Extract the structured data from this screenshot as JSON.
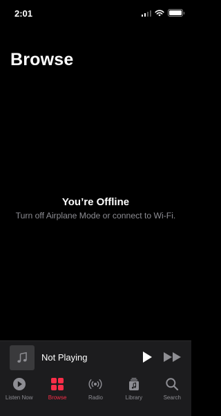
{
  "status_bar": {
    "time": "2:01"
  },
  "page": {
    "title": "Browse"
  },
  "offline": {
    "title": "You’re Offline",
    "subtitle": "Turn off Airplane Mode or connect to Wi-Fi."
  },
  "mini_player": {
    "label": "Not Playing",
    "artwork_icon": "music-note-icon",
    "play_icon": "play-icon",
    "forward_icon": "fast-forward-icon"
  },
  "tab_bar": {
    "tabs": [
      {
        "label": "Listen Now",
        "icon": "play-circle-icon",
        "active": false
      },
      {
        "label": "Browse",
        "icon": "grid-icon",
        "active": true
      },
      {
        "label": "Radio",
        "icon": "radio-broadcast-icon",
        "active": false
      },
      {
        "label": "Library",
        "icon": "library-icon",
        "active": false
      },
      {
        "label": "Search",
        "icon": "search-icon",
        "active": false
      }
    ]
  },
  "colors": {
    "accent": "#fa2d48",
    "background": "#000000",
    "bar_background": "#1c1c1e",
    "secondary_text": "#8d8d93"
  }
}
